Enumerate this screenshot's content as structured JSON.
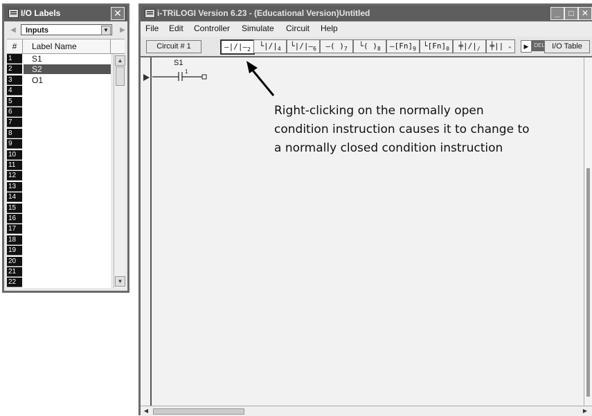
{
  "io_window": {
    "title": "I/O Labels",
    "close_glyph": "✕",
    "selector_value": "Inputs",
    "columns": {
      "number": "#",
      "label": "Label Name"
    },
    "rows": [
      {
        "num": "1",
        "label": "S1",
        "selected": false
      },
      {
        "num": "2",
        "label": "S2",
        "selected": true
      },
      {
        "num": "3",
        "label": "O1",
        "selected": false
      },
      {
        "num": "4",
        "label": "",
        "selected": false
      },
      {
        "num": "5",
        "label": "",
        "selected": false
      },
      {
        "num": "6",
        "label": "",
        "selected": false
      },
      {
        "num": "7",
        "label": "",
        "selected": false
      },
      {
        "num": "8",
        "label": "",
        "selected": false
      },
      {
        "num": "9",
        "label": "",
        "selected": false
      },
      {
        "num": "10",
        "label": "",
        "selected": false
      },
      {
        "num": "11",
        "label": "",
        "selected": false
      },
      {
        "num": "12",
        "label": "",
        "selected": false
      },
      {
        "num": "13",
        "label": "",
        "selected": false
      },
      {
        "num": "14",
        "label": "",
        "selected": false
      },
      {
        "num": "15",
        "label": "",
        "selected": false
      },
      {
        "num": "16",
        "label": "",
        "selected": false
      },
      {
        "num": "17",
        "label": "",
        "selected": false
      },
      {
        "num": "18",
        "label": "",
        "selected": false
      },
      {
        "num": "19",
        "label": "",
        "selected": false
      },
      {
        "num": "20",
        "label": "",
        "selected": false
      },
      {
        "num": "21",
        "label": "",
        "selected": false
      },
      {
        "num": "22",
        "label": "",
        "selected": false
      }
    ]
  },
  "main_window": {
    "title": "i-TRiLOGI Version 6.23 - (Educational Version)Untitled",
    "window_buttons": {
      "minimize": "_",
      "maximize": "□",
      "close": "✕"
    },
    "menu": [
      "File",
      "Edit",
      "Controller",
      "Simulate",
      "Circuit",
      "Help"
    ],
    "circuit_button": "Circuit # 1",
    "ladder_buttons": [
      {
        "glyph": "—|/|—",
        "key": "2",
        "pressed": true
      },
      {
        "glyph": "└|/|",
        "key": "4",
        "pressed": false
      },
      {
        "glyph": "└|/|—",
        "key": "6",
        "pressed": false
      },
      {
        "glyph": "—( )",
        "key": "7",
        "pressed": false
      },
      {
        "glyph": "└( )",
        "key": "8",
        "pressed": false
      },
      {
        "glyph": "—[Fn]",
        "key": "9",
        "pressed": false
      },
      {
        "glyph": "└[Fn]",
        "key": "0",
        "pressed": false
      },
      {
        "glyph": "╪|/|",
        "key": "/",
        "pressed": false
      },
      {
        "glyph": "╪|| ",
        "key": "^",
        "pressed": false
      }
    ],
    "play_glyph": "▶",
    "del_label": "DEL",
    "io_table_button": "I/O Table",
    "rung": {
      "contact_label": "S1",
      "contact_index": "1"
    }
  },
  "annotation": {
    "lines": [
      "Right-clicking on the normally open",
      "condition instruction causes it to change to",
      "a normally closed condition instruction"
    ]
  },
  "icons": {
    "app": "trilogi-app-icon",
    "scroll_up": "▲",
    "scroll_down": "▼",
    "left_arrow": "◀",
    "right_arrow": "▶"
  }
}
